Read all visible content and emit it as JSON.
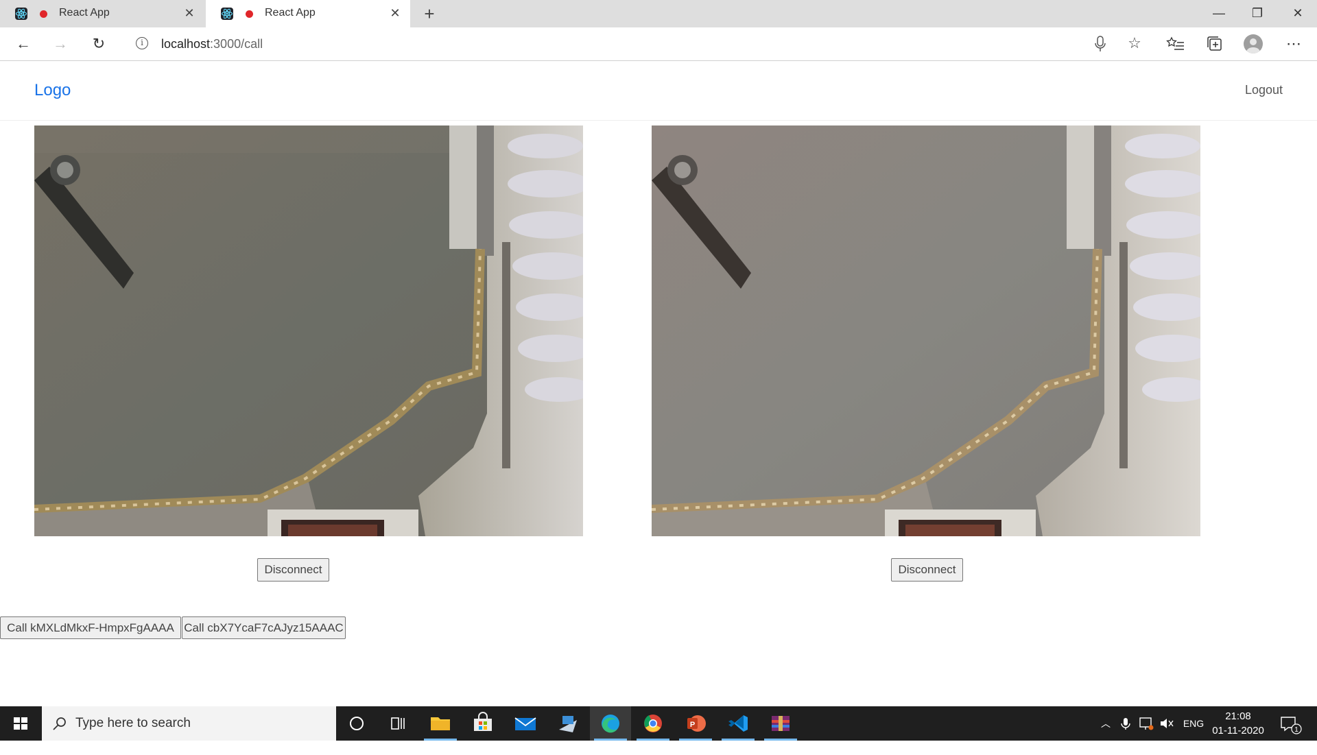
{
  "browser": {
    "tabs": [
      {
        "title": "React App",
        "active": false
      },
      {
        "title": "React App",
        "active": true
      }
    ],
    "address": {
      "host": "localhost",
      "rest": ":3000/call"
    }
  },
  "app": {
    "logo": "Logo",
    "logout": "Logout",
    "disconnect_label": "Disconnect",
    "call_buttons": [
      "Call kMXLdMkxF-HmpxFgAAAA",
      "Call cbX7YcaF7cAJyz15AAAC"
    ]
  },
  "taskbar": {
    "search_placeholder": "Type here to search",
    "apps": [
      "file-explorer",
      "microsoft-store",
      "mail",
      "remote-desktop",
      "edge",
      "chrome",
      "powerpoint",
      "vscode",
      "winrar"
    ],
    "active_app": "edge",
    "language": "ENG",
    "time": "21:08",
    "date": "01-11-2020",
    "notifications": "1"
  },
  "colors": {
    "accent": "#1a73e8",
    "recording": "#e0262a",
    "taskbar": "#1f1f1f"
  }
}
